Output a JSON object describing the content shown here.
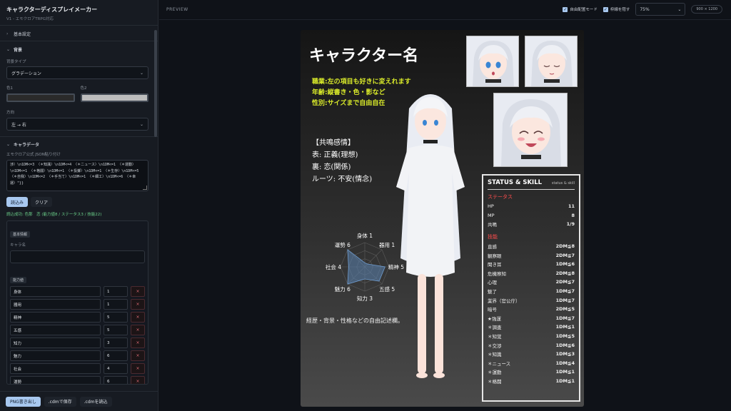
{
  "app": {
    "title": "キャラクターディスプレイメーカー",
    "subtitle": "V1 - エモクロアTRPG対応"
  },
  "sidebar": {
    "section_basic": "基本設定",
    "section_bg": "背景",
    "bg_type_label": "背景タイプ",
    "bg_type_value": "グラデーション",
    "color1_label": "色1",
    "color2_label": "色2",
    "color1": "#2a2a2a",
    "color2": "#bdbdbd",
    "direction_label": "方向",
    "direction_value": "左 → 右",
    "section_chardata": "キャラデータ",
    "json_label": "エモクロア公式 JSON貼り付け",
    "json_text": "渉）\\n1DM<=3 〈＊知識〉\\n1DM<=4 〈＊ニュース〉\\n1DM<=1 〈＊運動〉\\n1DM<=1 〈＊格闘〉\\n1DM<=1 〈＊投擲〉\\n1DM<=1 〈＊生存〉\\n1DM<=5 〈＊自我〉\\n1DM<=2 〈＊手当て〉\\n1DM<=1 〈＊細工〉\\n1DM<=6 〈＊幸運〉\"}}",
    "load_button": "読込み",
    "clear_button": "クリア",
    "success_text": "読込成功: 色那　恋 (能力値8 / ステータス3 / 技能22)",
    "basic_info_pill": "基本情報",
    "char_name_label": "キャラ名",
    "char_name_value": "",
    "ability_pill": "能力値",
    "stats": [
      {
        "name": "身体",
        "value": "1"
      },
      {
        "name": "器用",
        "value": "1"
      },
      {
        "name": "精神",
        "value": "5"
      },
      {
        "name": "五感",
        "value": "5"
      },
      {
        "name": "知力",
        "value": "3"
      },
      {
        "name": "魅力",
        "value": "6"
      },
      {
        "name": "社会",
        "value": "4"
      },
      {
        "name": "運勢",
        "value": "6"
      }
    ],
    "delete_symbol": "×",
    "footer": {
      "png_button": "PNG書き出し",
      "save_button": ".cdmで保存",
      "load_button": ".cdmを読込"
    }
  },
  "topbar": {
    "label": "PREVIEW",
    "free_layout": "自由配置モード",
    "hide_frame": "枠線を隠す",
    "zoom": "75%",
    "size": "900 × 1200"
  },
  "card": {
    "name": "キャラクター名",
    "yellow_lines": [
      "職業:左の項目も好きに変えれます",
      "年齢:縦書き・色・影など",
      "性別:サイズまで自由自在"
    ],
    "resonance": [
      "【共鳴感情】",
      "表: 正義(理想)",
      "裏: 恋(関係)",
      "ルーツ: 不安(情念)"
    ],
    "bio": "経歴・背景・性格などの自由記述欄。",
    "radar_labels": [
      "身体 1",
      "器用 1",
      "精神 5",
      "五感 5",
      "知力 3",
      "魅力 6",
      "社会 4",
      "運勢 6"
    ],
    "status_title": "STATUS & SKILL",
    "status_sub": "status & skill",
    "status_heading": "ステータス",
    "status": [
      {
        "k": "HP",
        "v": "11"
      },
      {
        "k": "MP",
        "v": "8"
      },
      {
        "k": "共鳴",
        "v": "1/9"
      }
    ],
    "skill_heading": "技能",
    "skills": [
      {
        "k": "直感",
        "v": "2DM≦8"
      },
      {
        "k": "観察眼",
        "v": "2DM≦7"
      },
      {
        "k": "聞き耳",
        "v": "1DM≦6"
      },
      {
        "k": "危機察知",
        "v": "2DM≦8"
      },
      {
        "k": "心理",
        "v": "2DM≦7"
      },
      {
        "k": "魅了",
        "v": "1DM≦7"
      },
      {
        "k": "業界（官公庁）",
        "v": "1DM≦7"
      },
      {
        "k": "暗号",
        "v": "2DM≦5"
      },
      {
        "k": "★強運",
        "v": "1DM≦7"
      },
      {
        "k": "＊調査",
        "v": "1DM≦1"
      },
      {
        "k": "＊知覚",
        "v": "1DM≦5"
      },
      {
        "k": "＊交渉",
        "v": "1DM≦6"
      },
      {
        "k": "＊知識",
        "v": "1DM≦3"
      },
      {
        "k": "＊ニュース",
        "v": "1DM≦4"
      },
      {
        "k": "＊運動",
        "v": "1DM≦1"
      },
      {
        "k": "＊格闘",
        "v": "1DM≦1"
      }
    ]
  },
  "colors": {
    "accent": "#a8c8ef",
    "status_red": "#ff4d4d",
    "yellow": "#d9ea2a"
  }
}
